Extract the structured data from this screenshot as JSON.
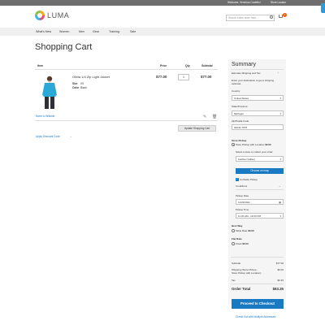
{
  "topbar": {
    "welcome": "Welcome, Veronica Costello!",
    "store_locator": "Store Locator"
  },
  "logo": {
    "text": "LUMA"
  },
  "header": {
    "search_placeholder": "Search entire store here...",
    "cart_count": "1"
  },
  "nav": {
    "items": [
      "What's New",
      "Women",
      "Men",
      "Gear",
      "Training",
      "Sale"
    ]
  },
  "page": {
    "title": "Shopping Cart"
  },
  "cart": {
    "headers": {
      "item": "Item",
      "price": "Price",
      "qty": "Qty",
      "subtotal": "Subtotal"
    },
    "item": {
      "name": "Olivia 1/4 Zip Light Jacket",
      "size_label": "Size",
      "size_value": "XS",
      "color_label": "Color",
      "color_value": "Black",
      "price": "$77.00",
      "qty": "1",
      "subtotal": "$77.00",
      "image_color": "#2aa9d6"
    },
    "move_to_wishlist": "Move to Wishlist",
    "update_button": "Update Shopping Cart",
    "apply_discount": "Apply Discount Code"
  },
  "summary": {
    "title": "Summary",
    "estimate_heading": "Estimate Shipping and Tax",
    "estimate_desc": "Enter your destination to get a shipping estimate.",
    "country_label": "Country",
    "country_value": "United States",
    "state_label": "State/Province",
    "state_value": "Michigan",
    "zip_label": "Zip/Postal Code",
    "zip_value": "94043-7978",
    "store_pickup_heading": "Store Pickup",
    "store_pickup_option": "Store Pickup with Location",
    "store_pickup_price": "$0.00",
    "select_store_label": "Select a store to collect your order:",
    "store_value": "Fashion Gallery",
    "choose_map_button": "Choose on map",
    "curbside_label": "Curbside Pickup",
    "conditions_label": "Conditions",
    "pickup_date_label": "Pickup Date",
    "pickup_date_value": "11/22/2021",
    "pickup_time_label": "Pickup Time",
    "pickup_time_value": "11:20 AM - 12:00 PM",
    "best_way_heading": "Best Way",
    "best_way_option": "Table Rate",
    "best_way_price": "$0.00",
    "flat_rate_heading": "Flat Rate",
    "flat_rate_option": "Fixed",
    "flat_rate_price": "$5.00",
    "subtotal_label": "Subtotal",
    "subtotal_value": "$77.00",
    "shipping_label": "Shipping (Store Pickup - Store Pickup with Location)",
    "shipping_value": "$0.00",
    "tax_label": "Tax",
    "tax_value": "$6.35",
    "order_total_label": "Order Total",
    "order_total_value": "$83.35",
    "checkout_button": "Proceed to Checkout",
    "multi_address_link": "Check Out with Multiple Addresses"
  },
  "colors": {
    "accent_blue": "#1979c3",
    "cart_badge": "#ff5501",
    "topbar": "#6e6e6e"
  }
}
